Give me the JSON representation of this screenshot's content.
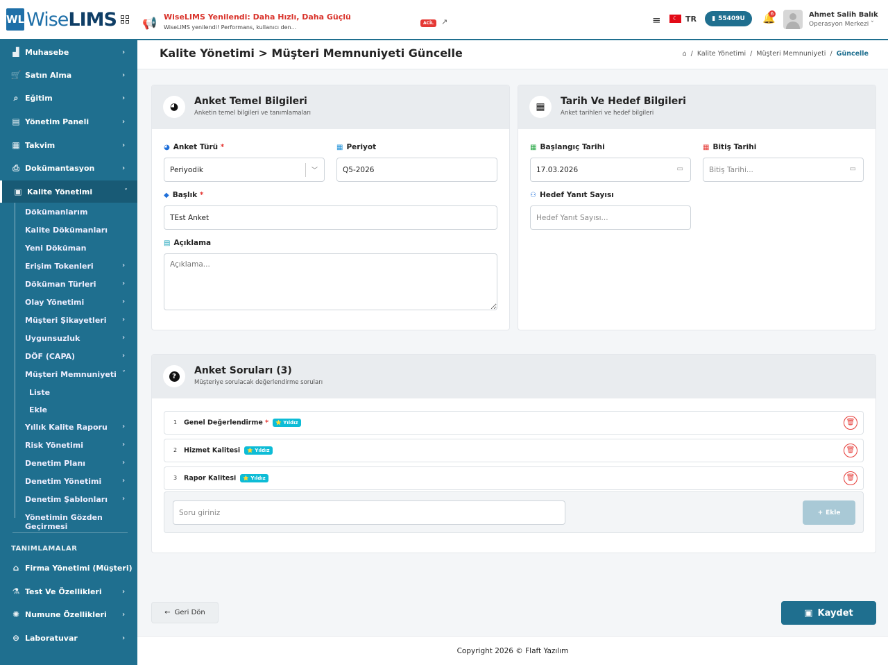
{
  "header": {
    "logo_wl": "WL",
    "logo_wise": "Wise",
    "logo_lims": "LIMS",
    "news_title": "WiseLIMS Yenilendi: Daha Hızlı, Daha Güçlü",
    "news_text": "WiseLIMS yenilendi! Performans, kullanıcı den...",
    "news_badge": "ACİL",
    "lang": "TR",
    "flag_glyph": "☾",
    "id_badge": "55409U",
    "notif_count": "6",
    "user_name": "Ahmet Salih Balık",
    "user_role": "Operasyon Merkezi ˅"
  },
  "sidebar": {
    "items": [
      {
        "label": "Muhasebe",
        "icon": "chart-icon"
      },
      {
        "label": "Satın Alma",
        "icon": "cart-icon"
      },
      {
        "label": "Eğitim",
        "icon": "search-icon"
      },
      {
        "label": "Yönetim Paneli",
        "icon": "calendar-icon"
      },
      {
        "label": "Takvim",
        "icon": "calendar-check-icon"
      },
      {
        "label": "Dokümantasyon",
        "icon": "document-icon"
      },
      {
        "label": "Kalite Yönetimi",
        "icon": "quality-icon"
      }
    ],
    "sub": [
      "Dökümanlarım",
      "Kalite Dökümanları",
      "Yeni Döküman",
      "Erişim Tokenleri",
      "Döküman Türleri",
      "Olay Yönetimi",
      "Müşteri Şikayetleri",
      "Uygunsuzluk",
      "DÖF (CAPA)",
      "Müşteri Memnuniyeti",
      "Liste",
      "Ekle",
      "Yıllık Kalite Raporu",
      "Risk Yönetimi",
      "Denetim Planı",
      "Denetim Yönetimi",
      "Denetim Şablonları",
      "Yönetimin Gözden Geçirmesi"
    ],
    "section_title": "TANIMLAMALAR",
    "def_items": [
      "Firma Yönetimi (Müşteri)",
      "Test Ve Özellikleri",
      "Numune Özellikleri",
      "Laboratuvar"
    ]
  },
  "page": {
    "title": "Kalite Yönetimi > Müşteri Memnuniyeti Güncelle",
    "breadcrumb": [
      "Kalite Yönetimi",
      "Müşteri Memnuniyeti",
      "Güncelle"
    ]
  },
  "card_basic": {
    "title": "Anket Temel Bilgileri",
    "subtitle": "Anketin temel bilgileri ve tanımlamaları",
    "type_label": "Anket Türü",
    "type_value": "Periyodik",
    "period_label": "Periyot",
    "period_value": "Q5-2026",
    "title_label": "Başlık",
    "title_value": "TEst Anket",
    "desc_label": "Açıklama",
    "desc_placeholder": "Açıklama..."
  },
  "card_dates": {
    "title": "Tarih Ve Hedef Bilgileri",
    "subtitle": "Anket tarihleri ve hedef bilgileri",
    "start_label": "Başlangıç Tarihi",
    "start_value": "17.03.2026",
    "end_label": "Bitiş Tarihi",
    "end_placeholder": "Bitiş Tarihi...",
    "target_label": "Hedef Yanıt Sayısı",
    "target_placeholder": "Hedef Yanıt Sayısı..."
  },
  "questions": {
    "title": "Anket Soruları (3)",
    "subtitle": "Müşteriye sorulacak değerlendirme soruları",
    "items": [
      {
        "num": "1",
        "text": "Genel Değerlendirme",
        "badge": "⭐ Yıldız"
      },
      {
        "num": "2",
        "text": "Hizmet Kalitesi",
        "badge": "⭐ Yıldız"
      },
      {
        "num": "3",
        "text": "Rapor Kalitesi",
        "badge": "⭐ Yıldız"
      }
    ],
    "input_placeholder": "Soru giriniz",
    "add_label": "Ekle"
  },
  "actions": {
    "back_label": "Geri Dön",
    "save_label": "Kaydet"
  },
  "footer": {
    "text": "Copyright 2026 © Flaft Yazılım"
  }
}
